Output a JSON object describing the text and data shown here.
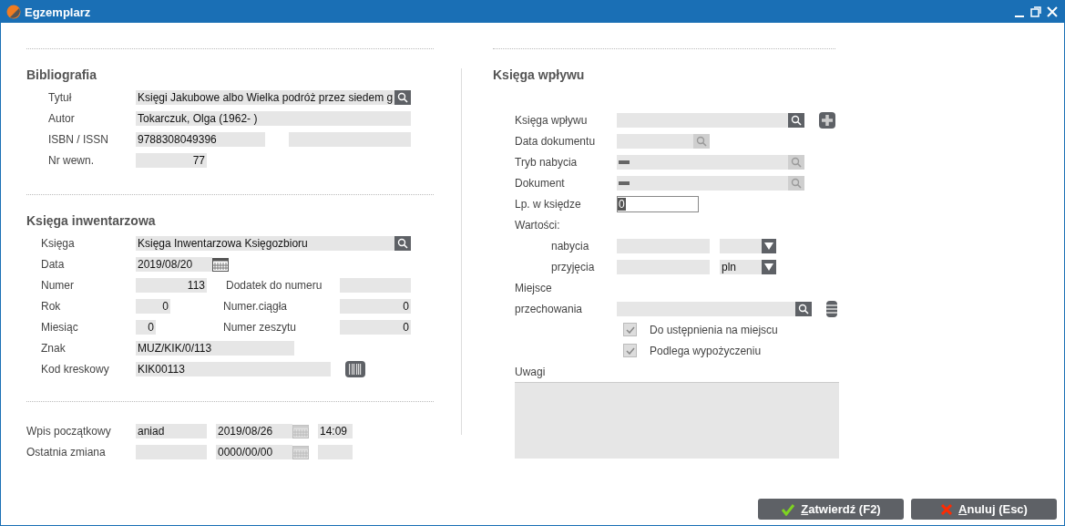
{
  "window": {
    "title": "Egzemplarz"
  },
  "bibliography": {
    "heading": "Bibliografia",
    "title": {
      "label": "Tytuł",
      "value": "Księgi Jakubowe albo Wielka podróż przez siedem g"
    },
    "author": {
      "label": "Autor",
      "value": "Tokarczuk, Olga (1962- )"
    },
    "isbn": {
      "label": "ISBN / ISSN",
      "value": "9788308049396"
    },
    "internal_no": {
      "label": "Nr wewn.",
      "value": "77"
    }
  },
  "inventory": {
    "heading": "Księga inwentarzowa",
    "book": {
      "label": "Księga",
      "value": "Księga Inwentarzowa Księgozbioru"
    },
    "date": {
      "label": "Data",
      "value": "2019/08/20"
    },
    "number": {
      "label": "Numer",
      "value": "113"
    },
    "number_suffix": {
      "label": "Dodatek do numeru"
    },
    "year": {
      "label": "Rok",
      "value": "0"
    },
    "serial": {
      "label": "Numer.ciągła",
      "value": "0"
    },
    "month": {
      "label": "Miesiąc",
      "value": "0"
    },
    "issue": {
      "label": "Numer zeszytu",
      "value": "0"
    },
    "sign": {
      "label": "Znak",
      "value": "MUZ/KIK/0/113"
    },
    "barcode": {
      "label": "Kod kreskowy",
      "value": "KIK00113"
    }
  },
  "history": [
    {
      "label": "Wpis początkowy",
      "user": "aniad",
      "date": "2019/08/26",
      "time": "14:09"
    },
    {
      "label": "Ostatnia zmiana",
      "date": "0000/00/00"
    }
  ],
  "accession": {
    "heading": "Księga wpływu",
    "book": {
      "label": "Księga wpływu",
      "disabled": false
    },
    "doc_date": {
      "label": "Data dokumentu",
      "disabled": true
    },
    "mode": {
      "label": "Tryb nabycia",
      "disabled": true
    },
    "document": {
      "label": "Dokument",
      "disabled": true
    },
    "position": {
      "label": "Lp. w księdze",
      "value": "0"
    },
    "values_label": "Wartości:",
    "acquisition": {
      "label": "nabycia"
    },
    "receipt": {
      "label": "przyjęcia",
      "currency": "pln"
    },
    "location_label_1": "Miejsce",
    "location_label_2": "przechowania",
    "checks": [
      {
        "label": "Do ustępnienia na miejscu",
        "checked": true
      },
      {
        "label": "Podlega wypożyczeniu",
        "checked": true
      }
    ],
    "notes_label": "Uwagi"
  },
  "buttons": [
    {
      "kind": "confirm",
      "label": "Zatwierdź (F2)"
    },
    {
      "kind": "cancel",
      "label": "Anuluj (Esc)"
    }
  ]
}
